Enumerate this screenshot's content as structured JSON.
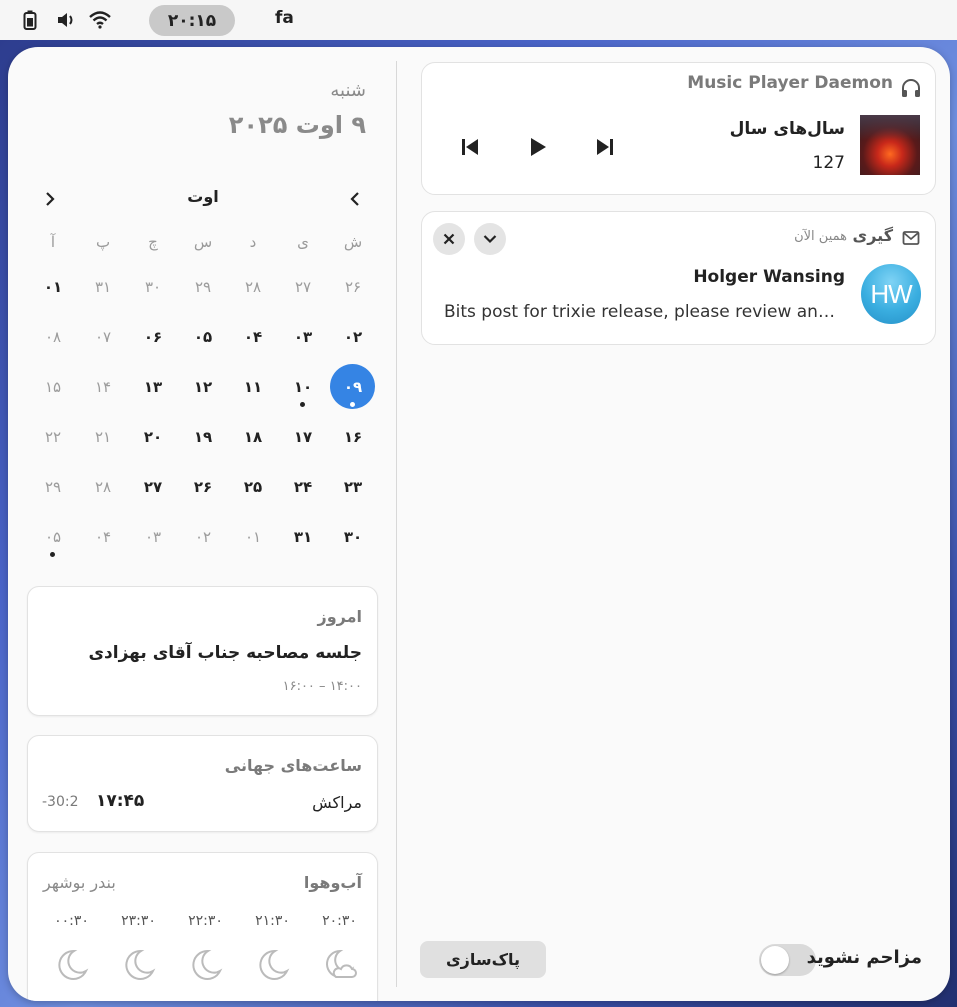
{
  "topbar": {
    "clock": "۲۰:۱۵",
    "language": "fa",
    "icons": [
      "battery-icon",
      "volume-icon",
      "wifi-icon"
    ]
  },
  "date_header": {
    "day_name": "شنبه",
    "full_date": "۹ اوت ۲۰۲۵"
  },
  "calendar": {
    "month": "اوت",
    "weekdays": [
      "ش",
      "ی",
      "د",
      "س",
      "چ",
      "پ",
      "آ"
    ],
    "weeks": [
      [
        {
          "d": "۲۶",
          "s": "dim"
        },
        {
          "d": "۲۷",
          "s": "dim"
        },
        {
          "d": "۲۸",
          "s": "dim"
        },
        {
          "d": "۲۹",
          "s": "dim"
        },
        {
          "d": "۳۰",
          "s": "dim"
        },
        {
          "d": "۳۱",
          "s": "dim"
        },
        {
          "d": "۰۱",
          "s": "bold"
        }
      ],
      [
        {
          "d": "۰۲",
          "s": "bold"
        },
        {
          "d": "۰۳",
          "s": "bold"
        },
        {
          "d": "۰۴",
          "s": "bold"
        },
        {
          "d": "۰۵",
          "s": "bold"
        },
        {
          "d": "۰۶",
          "s": "bold"
        },
        {
          "d": "۰۷",
          "s": "dim"
        },
        {
          "d": "۰۸",
          "s": "dim"
        }
      ],
      [
        {
          "d": "۰۹",
          "s": "today",
          "dot": true
        },
        {
          "d": "۱۰",
          "s": "bold",
          "dot": true
        },
        {
          "d": "۱۱",
          "s": "bold"
        },
        {
          "d": "۱۲",
          "s": "bold"
        },
        {
          "d": "۱۳",
          "s": "bold"
        },
        {
          "d": "۱۴",
          "s": "dim"
        },
        {
          "d": "۱۵",
          "s": "dim"
        }
      ],
      [
        {
          "d": "۱۶",
          "s": "bold"
        },
        {
          "d": "۱۷",
          "s": "bold"
        },
        {
          "d": "۱۸",
          "s": "bold"
        },
        {
          "d": "۱۹",
          "s": "bold"
        },
        {
          "d": "۲۰",
          "s": "bold"
        },
        {
          "d": "۲۱",
          "s": "dim"
        },
        {
          "d": "۲۲",
          "s": "dim"
        }
      ],
      [
        {
          "d": "۲۳",
          "s": "bold"
        },
        {
          "d": "۲۴",
          "s": "bold"
        },
        {
          "d": "۲۵",
          "s": "bold"
        },
        {
          "d": "۲۶",
          "s": "bold"
        },
        {
          "d": "۲۷",
          "s": "bold"
        },
        {
          "d": "۲۸",
          "s": "dim"
        },
        {
          "d": "۲۹",
          "s": "dim"
        }
      ],
      [
        {
          "d": "۳۰",
          "s": "bold"
        },
        {
          "d": "۳۱",
          "s": "bold"
        },
        {
          "d": "۰۱",
          "s": "dim"
        },
        {
          "d": "۰۲",
          "s": "dim"
        },
        {
          "d": "۰۳",
          "s": "dim"
        },
        {
          "d": "۰۴",
          "s": "dim"
        },
        {
          "d": "۰۵",
          "s": "dim",
          "dot": true
        }
      ]
    ]
  },
  "events": {
    "title": "امروز",
    "event_title": "جلسه مصاحبه جناب آقای بهزادی",
    "event_time": "۱۴:۰۰ – ۱۶:۰۰"
  },
  "world_clocks": {
    "title": "ساعت‌های جهانی",
    "city": "مراکش",
    "time": "۱۷:۴۵",
    "offset": "-30:2"
  },
  "weather": {
    "title": "آب‌وهوا",
    "location": "بندر بوشهر",
    "forecast": [
      {
        "time": "۲۰:۳۰",
        "icon": "night-cloudy-icon"
      },
      {
        "time": "۲۱:۳۰",
        "icon": "moon-icon"
      },
      {
        "time": "۲۲:۳۰",
        "icon": "moon-icon"
      },
      {
        "time": "۲۳:۳۰",
        "icon": "moon-icon"
      },
      {
        "time": "۰۰:۳۰",
        "icon": "moon-icon"
      }
    ]
  },
  "media": {
    "source": "Music Player Daemon",
    "title": "سال‌های سال",
    "artist": "127"
  },
  "notification": {
    "app": "گیری",
    "when": "همین الآن",
    "sender": "Holger Wansing",
    "body": "Bits post for trixie release, please review and translate",
    "avatar_initials": "HW"
  },
  "footer": {
    "clear_label": "پاک‌سازی",
    "dnd_label": "مزاحم نشوید",
    "dnd_enabled": false
  },
  "colors": {
    "accent": "#3584e4",
    "popover_bg": "#fafafa",
    "card_bg": "#ffffff"
  }
}
